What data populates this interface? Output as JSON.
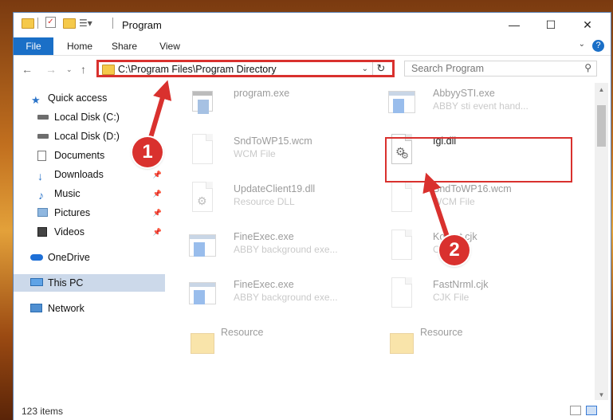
{
  "window": {
    "title": "Program",
    "minimize": "—",
    "maximize": "☐",
    "close": "✕"
  },
  "ribbon": {
    "tabs": [
      "File",
      "Home",
      "Share",
      "View"
    ],
    "help": "?"
  },
  "address": {
    "path": "C:\\Program Files\\Program Directory",
    "search_placeholder": "Search Program"
  },
  "sidebar": {
    "items": [
      {
        "label": "Quick access",
        "icon": "star-icon"
      },
      {
        "label": "Local Disk (C:)",
        "icon": "drive-icon"
      },
      {
        "label": "Local Disk (D:)",
        "icon": "drive-icon"
      },
      {
        "label": "Documents",
        "icon": "documents-icon"
      },
      {
        "label": "Downloads",
        "icon": "download-icon"
      },
      {
        "label": "Music",
        "icon": "music-icon"
      },
      {
        "label": "Pictures",
        "icon": "pictures-icon"
      },
      {
        "label": "Videos",
        "icon": "videos-icon"
      },
      {
        "label": "OneDrive",
        "icon": "cloud-icon"
      },
      {
        "label": "This PC",
        "icon": "computer-icon"
      },
      {
        "label": "Network",
        "icon": "network-icon"
      }
    ]
  },
  "files": [
    {
      "name": "program.exe",
      "type": ""
    },
    {
      "name": "AbbyySTI.exe",
      "type": "ABBY sti event hand..."
    },
    {
      "name": "SndToWP15.wcm",
      "type": "WCM File"
    },
    {
      "name": "Igi.dll",
      "type": ""
    },
    {
      "name": "UpdateClient19.dll",
      "type": "Resource DLL"
    },
    {
      "name": "SndToWP16.wcm",
      "type": "WCM File"
    },
    {
      "name": "FineExec.exe",
      "type": "ABBY background exe..."
    },
    {
      "name": "Kornet.cjk",
      "type": "CJK File"
    },
    {
      "name": "FineExec.exe",
      "type": "ABBY background exe..."
    },
    {
      "name": "FastNrml.cjk",
      "type": "CJK File"
    },
    {
      "name": "Resource",
      "type": ""
    },
    {
      "name": "Resource",
      "type": ""
    }
  ],
  "status": {
    "count": "123 items"
  },
  "annotations": {
    "step1": "1",
    "step2": "2",
    "color": "#d9312e"
  }
}
